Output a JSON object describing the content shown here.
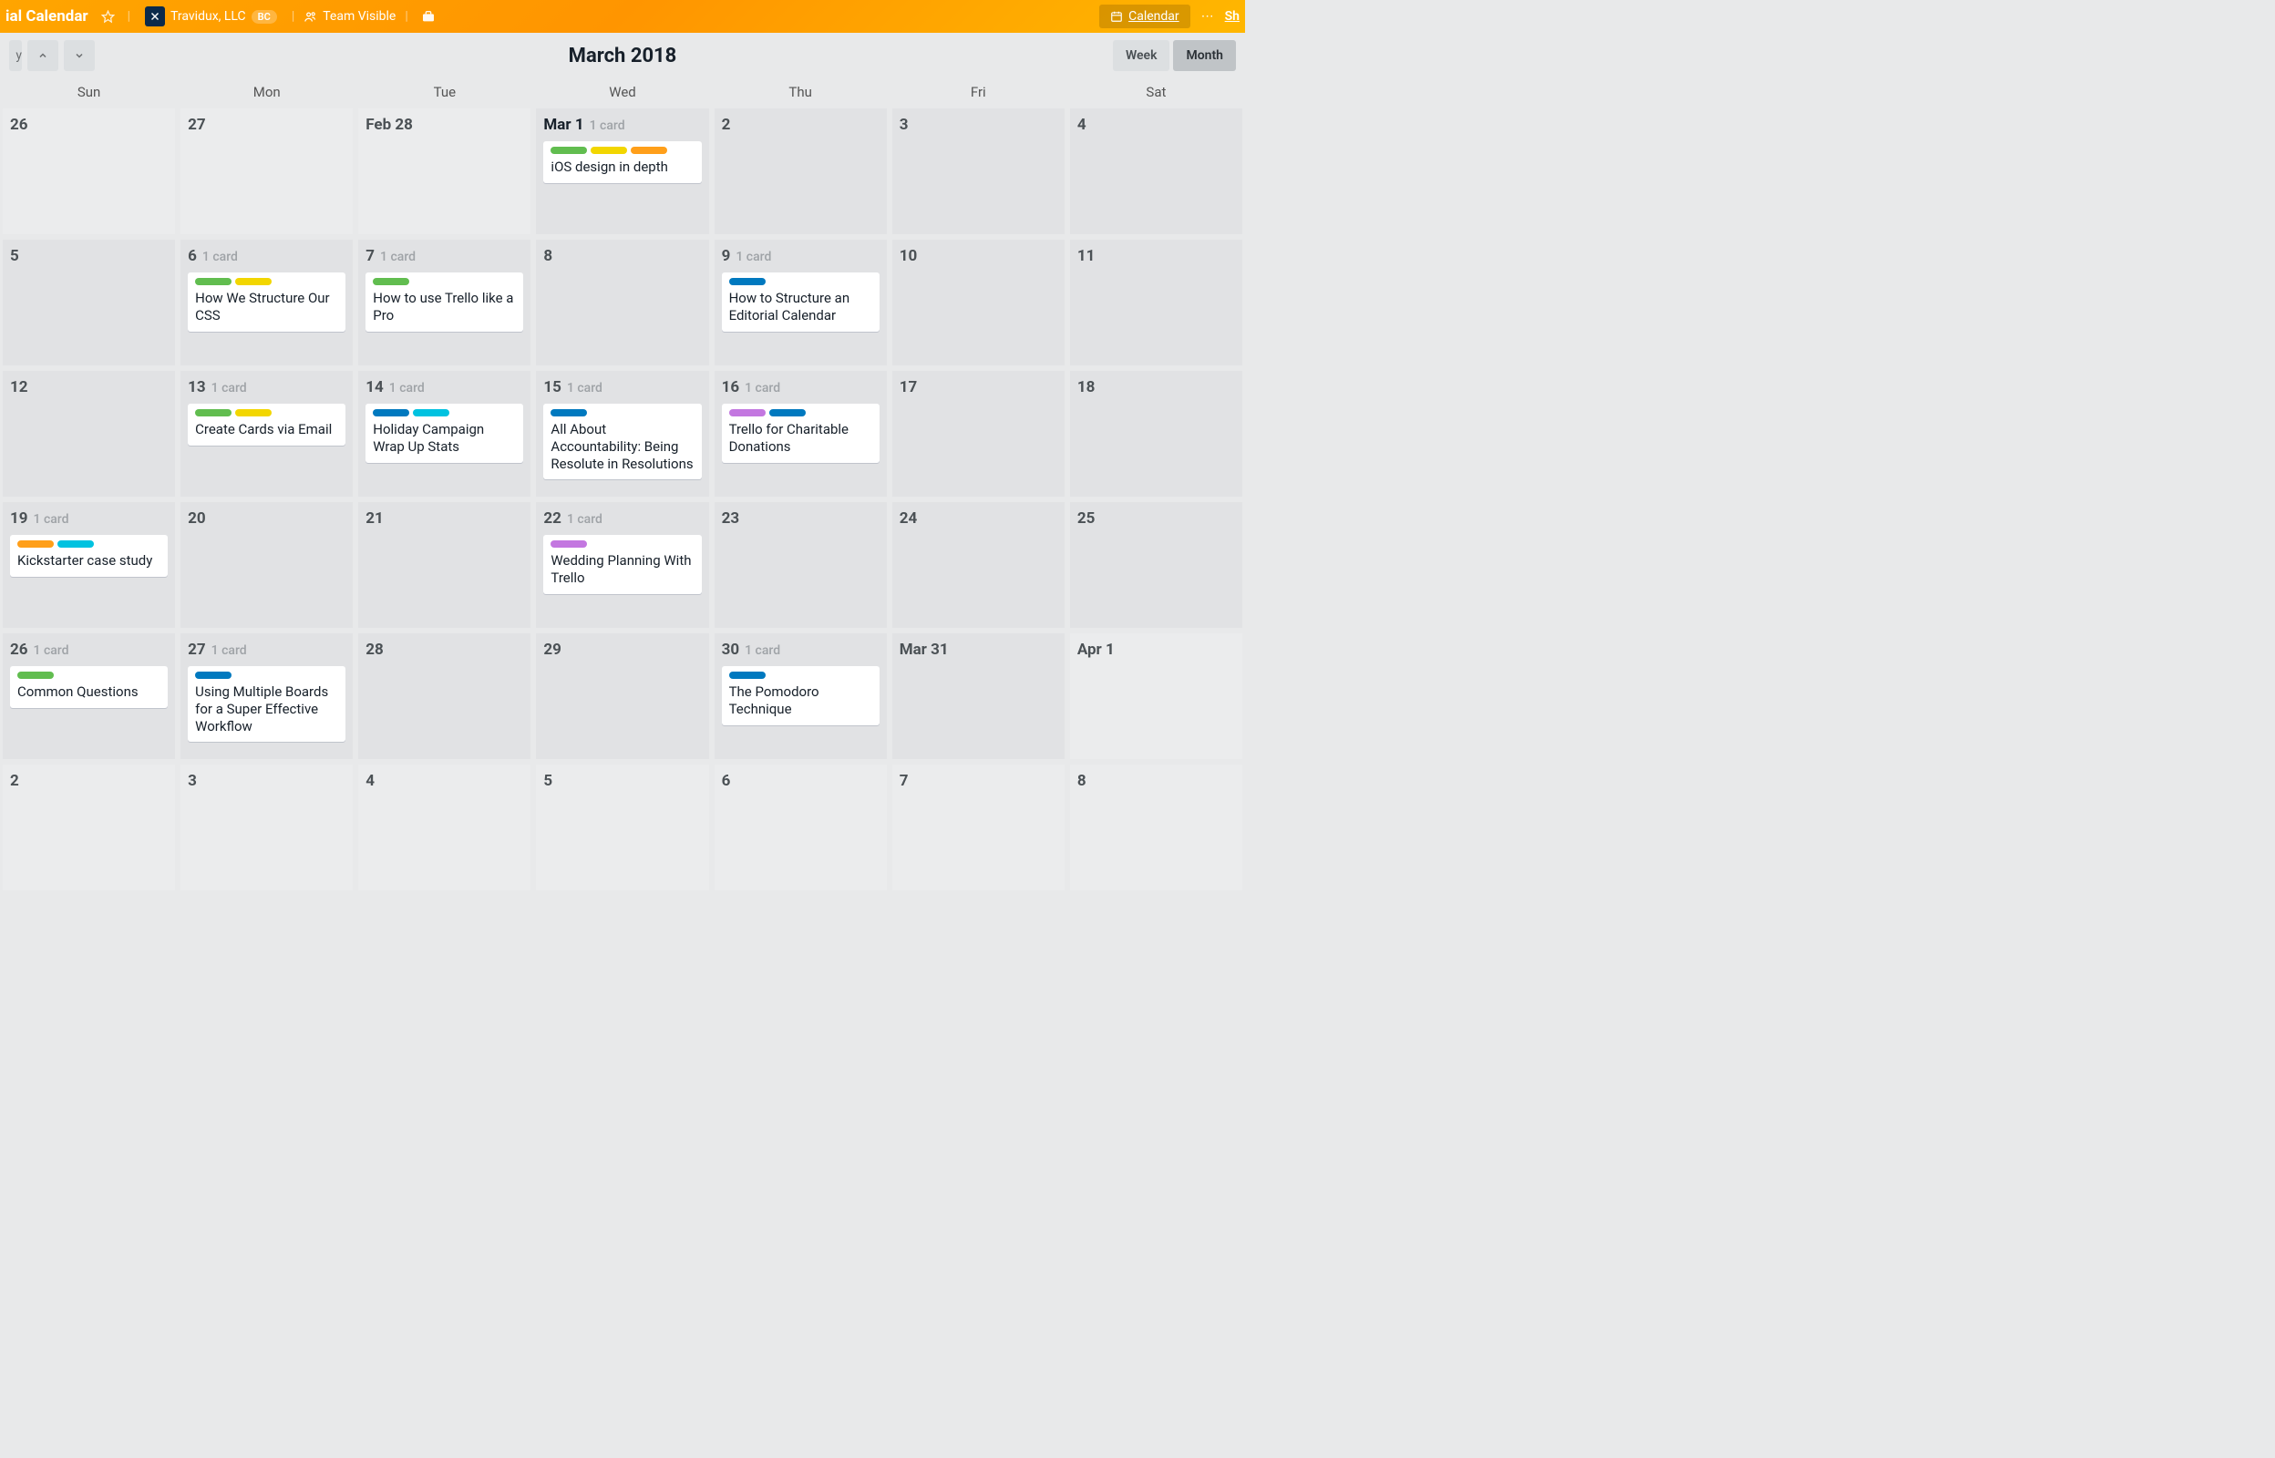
{
  "header": {
    "board_name_suffix": "ial Calendar",
    "org_name": "Travidux, LLC",
    "org_badge": "BC",
    "visibility": "Team Visible",
    "calendar_btn": "Calendar",
    "share_suffix": "Sh"
  },
  "calendar": {
    "title": "March 2018",
    "today_btn_suffix": "y",
    "view_week": "Week",
    "view_month": "Month",
    "dow": [
      "Sun",
      "Mon",
      "Tue",
      "Wed",
      "Thu",
      "Fri",
      "Sat"
    ],
    "cells": [
      {
        "label": "26",
        "out": true
      },
      {
        "label": "27",
        "out": true
      },
      {
        "label": "Feb 28",
        "out": true
      },
      {
        "label": "Mar 1",
        "today": true,
        "count": "1 card",
        "cards": [
          {
            "labels": [
              "green",
              "yellow",
              "orange"
            ],
            "title": "iOS design in depth"
          }
        ]
      },
      {
        "label": "2"
      },
      {
        "label": "3"
      },
      {
        "label": "4"
      },
      {
        "label": "5"
      },
      {
        "label": "6",
        "count": "1 card",
        "cards": [
          {
            "labels": [
              "green",
              "yellow"
            ],
            "title": "How We Structure Our CSS"
          }
        ]
      },
      {
        "label": "7",
        "count": "1 card",
        "cards": [
          {
            "labels": [
              "green"
            ],
            "title": "How to use Trello like a Pro"
          }
        ]
      },
      {
        "label": "8"
      },
      {
        "label": "9",
        "count": "1 card",
        "cards": [
          {
            "labels": [
              "blue"
            ],
            "title": "How to Structure an Editorial Calendar"
          }
        ]
      },
      {
        "label": "10"
      },
      {
        "label": "11"
      },
      {
        "label": "12"
      },
      {
        "label": "13",
        "count": "1 card",
        "cards": [
          {
            "labels": [
              "green",
              "yellow"
            ],
            "title": "Create Cards via Email"
          }
        ]
      },
      {
        "label": "14",
        "count": "1 card",
        "cards": [
          {
            "labels": [
              "blue",
              "teal"
            ],
            "title": "Holiday Campaign Wrap Up Stats"
          }
        ]
      },
      {
        "label": "15",
        "count": "1 card",
        "cards": [
          {
            "labels": [
              "blue"
            ],
            "title": "All About Accountability: Being Resolute in Resolutions"
          }
        ]
      },
      {
        "label": "16",
        "count": "1 card",
        "cards": [
          {
            "labels": [
              "purple",
              "blue"
            ],
            "title": "Trello for Charitable Donations"
          }
        ]
      },
      {
        "label": "17"
      },
      {
        "label": "18"
      },
      {
        "label": "19",
        "count": "1 card",
        "cards": [
          {
            "labels": [
              "orange",
              "teal"
            ],
            "title": "Kickstarter case study"
          }
        ]
      },
      {
        "label": "20"
      },
      {
        "label": "21"
      },
      {
        "label": "22",
        "count": "1 card",
        "cards": [
          {
            "labels": [
              "purple"
            ],
            "title": "Wedding Planning With Trello"
          }
        ]
      },
      {
        "label": "23"
      },
      {
        "label": "24"
      },
      {
        "label": "25"
      },
      {
        "label": "26",
        "count": "1 card",
        "cards": [
          {
            "labels": [
              "green"
            ],
            "title": "Common Questions"
          }
        ]
      },
      {
        "label": "27",
        "count": "1 card",
        "cards": [
          {
            "labels": [
              "blue"
            ],
            "title": "Using Multiple Boards for a Super Effective Workflow"
          }
        ]
      },
      {
        "label": "28"
      },
      {
        "label": "29"
      },
      {
        "label": "30",
        "count": "1 card",
        "cards": [
          {
            "labels": [
              "blue"
            ],
            "title": "The Pomodoro Technique"
          }
        ]
      },
      {
        "label": "Mar 31"
      },
      {
        "label": "Apr 1",
        "out": true
      },
      {
        "label": "2",
        "out": true
      },
      {
        "label": "3",
        "out": true
      },
      {
        "label": "4",
        "out": true
      },
      {
        "label": "5",
        "out": true
      },
      {
        "label": "6",
        "out": true
      },
      {
        "label": "7",
        "out": true
      },
      {
        "label": "8",
        "out": true
      }
    ]
  },
  "label_colors": {
    "green": "lbl-green",
    "yellow": "lbl-yellow",
    "orange": "lbl-orange",
    "blue": "lbl-blue",
    "teal": "lbl-teal",
    "purple": "lbl-purple"
  }
}
